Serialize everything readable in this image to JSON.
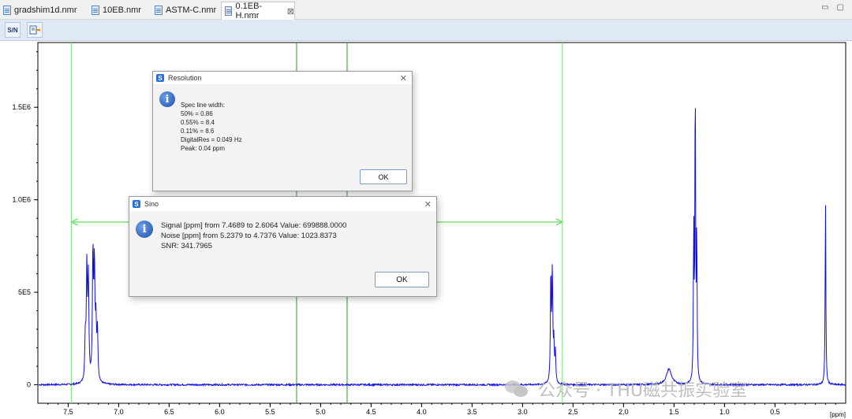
{
  "tabs": [
    {
      "label": "gradshim1d.nmr",
      "active": false
    },
    {
      "label": "10EB.nmr",
      "active": false
    },
    {
      "label": "ASTM-C.nmr",
      "active": false
    },
    {
      "label": "0.1EB-H.nmr",
      "active": true
    }
  ],
  "tab_close_glyph": "⊠",
  "window_buttons": [
    "▭",
    "▢"
  ],
  "toolbar": {
    "btn1_label": "S/N",
    "btn2_icon": "export-icon"
  },
  "resolution_dialog": {
    "title": "Resolution",
    "lines": [
      "Spec line width:",
      "50% = 0.86",
      "0.55% = 8.4",
      "0.11% = 8.6",
      "DigitalRes = 0.049 Hz",
      "Peak: 0.04 ppm"
    ],
    "ok_label": "OK"
  },
  "sino_dialog": {
    "title": "Sino",
    "lines": [
      "Signal [ppm] from 7.4689 to 2.6064 Value: 699888.0000",
      "Noise [ppm] from 5.2379 to 4.7376 Value: 1023.8373",
      "SNR: 341.7965"
    ],
    "ok_label": "OK"
  },
  "app_icon_glyph": "S",
  "info_glyph": "i",
  "watermark_text": "公众号 · THU磁共振实验室",
  "colors": {
    "spectrum": "#1010d8",
    "cursor_light": "#7be07b",
    "cursor_dark": "#2e9a2e",
    "toolbar_bg": "#dfe8f5"
  },
  "chart_data": {
    "type": "line",
    "xlabel": "[ppm]",
    "x_reversed": true,
    "xlim": [
      7.8,
      -0.2
    ],
    "ylim": [
      -100000,
      1850000
    ],
    "x_ticks": [
      "7.5",
      "7.0",
      "6.5",
      "6.0",
      "5.5",
      "5.0",
      "4.5",
      "4.0",
      "3.5",
      "3.0",
      "2.5",
      "2.0",
      "1.5",
      "1.0",
      "0.5"
    ],
    "x_tick_values": [
      7.5,
      7.0,
      6.5,
      6.0,
      5.5,
      5.0,
      4.5,
      4.0,
      3.5,
      3.0,
      2.5,
      2.0,
      1.5,
      1.0,
      0.5
    ],
    "y_ticks": [
      "0",
      "5E5",
      "1.0E6",
      "1.5E6"
    ],
    "y_tick_values": [
      0,
      500000,
      1000000,
      1500000
    ],
    "peaks_ppm": [
      {
        "ppm": 7.33,
        "height": 230000,
        "width": 0.006
      },
      {
        "ppm": 7.315,
        "height": 600000,
        "width": 0.006
      },
      {
        "ppm": 7.3,
        "height": 540000,
        "width": 0.006
      },
      {
        "ppm": 7.255,
        "height": 690000,
        "width": 0.006
      },
      {
        "ppm": 7.24,
        "height": 600000,
        "width": 0.006
      },
      {
        "ppm": 7.225,
        "height": 290000,
        "width": 0.006
      },
      {
        "ppm": 7.21,
        "height": 260000,
        "width": 0.006
      },
      {
        "ppm": 2.72,
        "height": 590000,
        "width": 0.005
      },
      {
        "ppm": 2.705,
        "height": 600000,
        "width": 0.005
      },
      {
        "ppm": 2.69,
        "height": 200000,
        "width": 0.005
      },
      {
        "ppm": 2.675,
        "height": 160000,
        "width": 0.005
      },
      {
        "ppm": 1.55,
        "height": 85000,
        "width": 0.03
      },
      {
        "ppm": 1.305,
        "height": 830000,
        "width": 0.004
      },
      {
        "ppm": 1.29,
        "height": 1640000,
        "width": 0.004
      },
      {
        "ppm": 1.275,
        "height": 810000,
        "width": 0.004
      },
      {
        "ppm": 0.0,
        "height": 1010000,
        "width": 0.004
      }
    ],
    "cursors_ppm": [
      {
        "ppm": 7.4689,
        "style": "light"
      },
      {
        "ppm": 5.2379,
        "style": "dark"
      },
      {
        "ppm": 4.7376,
        "style": "dark"
      },
      {
        "ppm": 2.6064,
        "style": "light"
      }
    ],
    "signal_range_arrow": {
      "from": 7.4689,
      "to": 2.6064,
      "y": 880000
    }
  }
}
